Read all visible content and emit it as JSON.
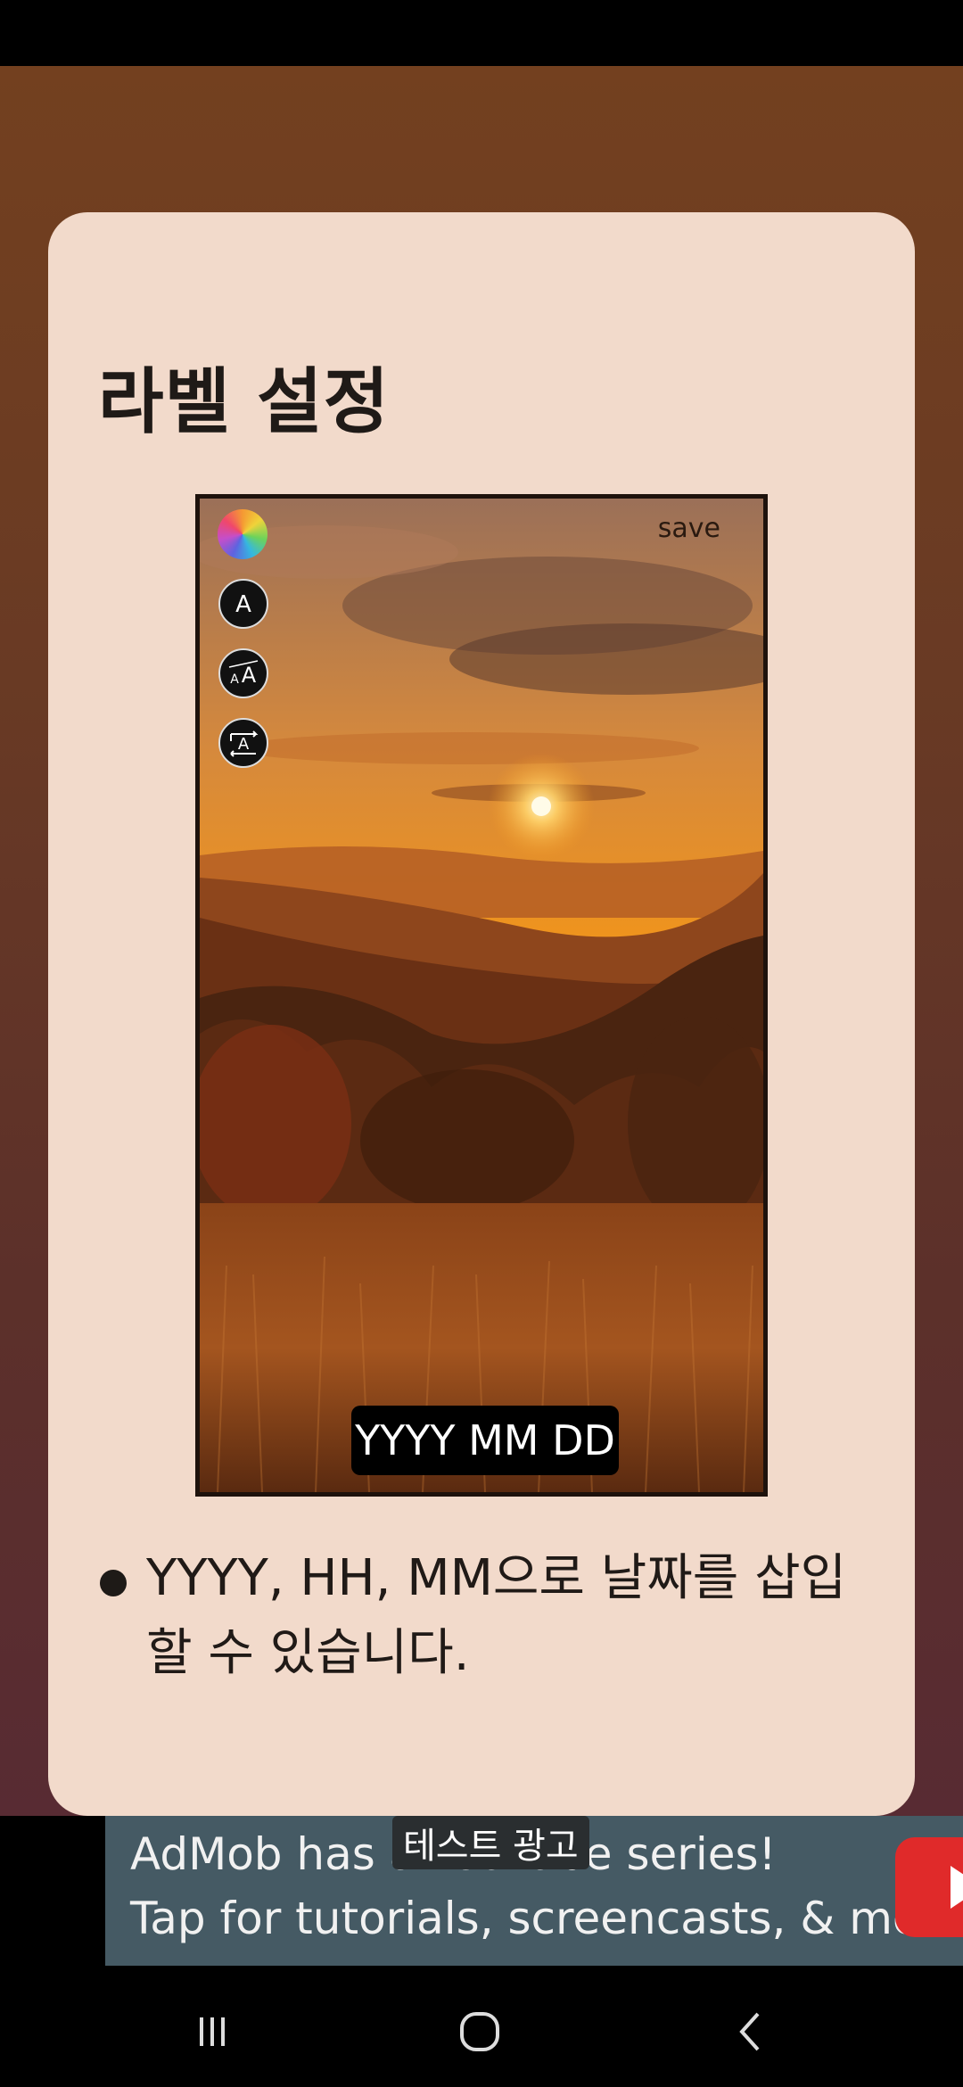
{
  "page": {
    "title": "라벨 설정",
    "description": "YYYY, HH, MM으로 날짜를 삽입할 수 있습니다."
  },
  "preview": {
    "save_label": "save",
    "date_label": "YYYY MM DD",
    "tools": [
      "palette-icon",
      "font-icon",
      "font-size-icon",
      "text-rotate-icon"
    ]
  },
  "ad": {
    "badge": "테스트 광고",
    "line1": "AdMob has a YouTube series!",
    "line2": "Tap for tutorials, screencasts, & more."
  },
  "navigation": {
    "buttons": [
      "recent-apps-icon",
      "home-icon",
      "back-icon"
    ]
  },
  "colors": {
    "card_background": "#f2dacb",
    "backdrop_top": "#73401f",
    "backdrop_bottom": "#582b33",
    "ad_background": "#455a64"
  }
}
